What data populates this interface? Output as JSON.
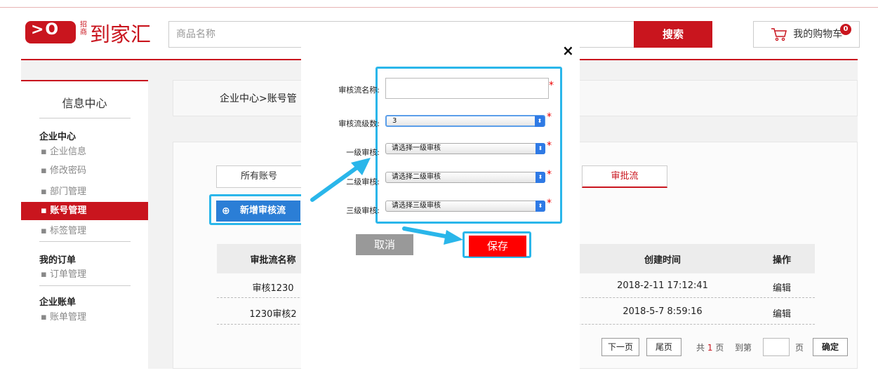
{
  "header": {
    "logo_symbol": ">O",
    "logo_small": "招商",
    "logo_text": "到家汇",
    "search_placeholder": "商品名称",
    "search_button": "搜索",
    "cart_label": "我的购物车",
    "cart_count": "0"
  },
  "sidebar": {
    "title": "信息中心",
    "groups": [
      {
        "title": "企业中心",
        "items": [
          "企业信息",
          "修改密码",
          "部门管理",
          "账号管理",
          "标签管理"
        ],
        "active": "账号管理"
      },
      {
        "title": "我的订单",
        "items": [
          "订单管理"
        ]
      },
      {
        "title": "企业账单",
        "items": [
          "账单管理"
        ]
      }
    ]
  },
  "breadcrumb": "企业中心>账号管",
  "tabs": {
    "all_accounts": "所有账号",
    "approval_flow": "审批流"
  },
  "add_button": "新增审核流",
  "table": {
    "headers": {
      "name": "审批流名称",
      "created": "创建时间",
      "action": "操作"
    },
    "rows": [
      {
        "name": "审核1230",
        "created": "2018-2-11 17:12:41",
        "action": "编辑"
      },
      {
        "name": "1230审核2",
        "created": "2018-5-7 8:59:16",
        "action": "编辑"
      }
    ]
  },
  "pager": {
    "next": "下一页",
    "last": "尾页",
    "total_prefix": "共",
    "total": "1",
    "total_suffix": "页",
    "goto": "到第",
    "page_unit": "页",
    "confirm": "确定"
  },
  "modal": {
    "close": "×",
    "name_label": "审核流名称:",
    "levels_label": "审核流级数:",
    "levels_value": "3",
    "level1_label": "一级审核:",
    "level1_value": "请选择一级审核",
    "level2_label": "二级审核:",
    "level2_value": "请选择二级审核",
    "level3_label": "三级审核:",
    "level3_value": "请选择三级审核",
    "required": "*",
    "cancel": "取消",
    "save": "保存"
  },
  "colors": {
    "brand_red": "#c9151e",
    "highlight_blue": "#2ab6ea",
    "add_button_blue": "#2b7ed6",
    "save_red": "#ff0000"
  }
}
